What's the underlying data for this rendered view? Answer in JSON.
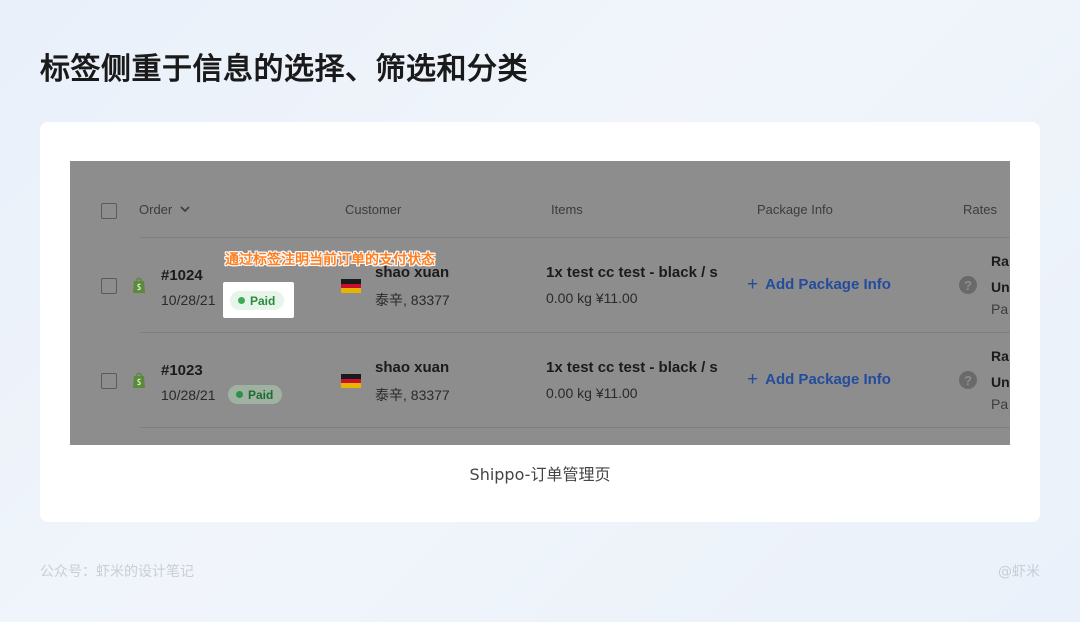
{
  "headline": "标签侧重于信息的选择、筛选和分类",
  "table": {
    "headers": {
      "order": "Order",
      "customer": "Customer",
      "items": "Items",
      "package_info": "Package Info",
      "rates": "Rates"
    },
    "rows": [
      {
        "order_no": "#1024",
        "date": "10/28/21",
        "status": "Paid",
        "customer_name": "shao xuan",
        "customer_address": "泰辛, 83377",
        "item_title": "1x test cc test - black / s",
        "item_meta": "0.00 kg  ¥11.00",
        "add_package": "Add Package Info",
        "rates_lines": [
          "Ra",
          "Un",
          "Pa"
        ]
      },
      {
        "order_no": "#1023",
        "date": "10/28/21",
        "status": "Paid",
        "customer_name": "shao xuan",
        "customer_address": "泰辛, 83377",
        "item_title": "1x test cc test - black / s",
        "item_meta": "0.00 kg  ¥11.00",
        "add_package": "Add Package Info",
        "rates_lines": [
          "Ra",
          "Un",
          "Pa"
        ]
      }
    ]
  },
  "annotation": "通过标签注明当前订单的支付状态",
  "caption": "Shippo-订单管理页",
  "footer": {
    "left": "公众号：虾米的设计笔记",
    "right": "@虾米"
  },
  "colors": {
    "accent_orange": "#ff7e1f",
    "paid_green": "#2b8a3e",
    "link_blue": "#234c9c",
    "overlay_gray": "#8d8d8d"
  },
  "icons": [
    "chevron-down-icon",
    "shopify-icon",
    "germany-flag-icon",
    "help-icon",
    "plus-icon"
  ]
}
